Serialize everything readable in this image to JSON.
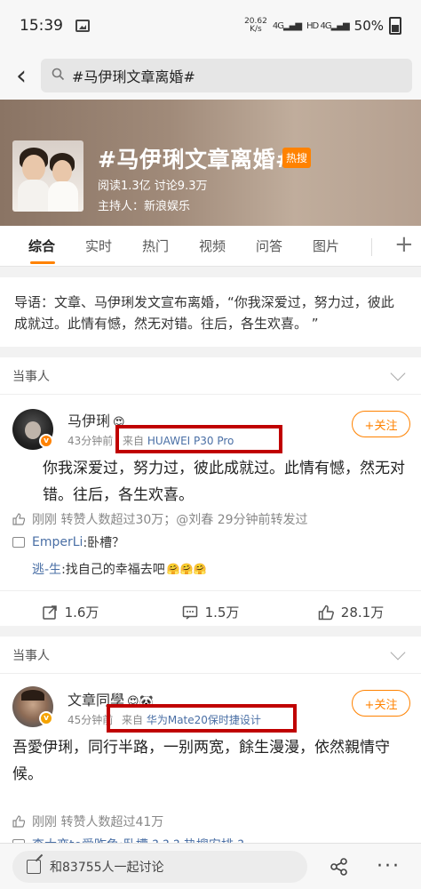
{
  "status": {
    "time": "15:39",
    "speed_top": "20.62",
    "speed_unit": "K/s",
    "network": "4G",
    "hd": "HD",
    "battery": "50%"
  },
  "search": {
    "query": "#马伊琍文章离婚#"
  },
  "topic": {
    "title": "#马伊琍文章离婚#",
    "badge": "热搜",
    "stats": "阅读1.3亿  讨论9.3万",
    "host": "主持人：新浪娱乐"
  },
  "tabs": [
    "综合",
    "实时",
    "热门",
    "视频",
    "问答",
    "图片"
  ],
  "guide": "导语：文章、马伊琍发文宣布离婚，“你我深爱过，努力过，彼此成就过。此情有憾，然无对错。往后，各生欢喜。 ”",
  "posts": [
    {
      "section": "当事人",
      "name": "马伊琍",
      "time": "43分钟前",
      "source_prefix": "来自",
      "device": "HUAWEI P30 Pro",
      "follow": "+关注",
      "body": "你我深爱过，努力过，彼此成就过。此情有憾，然无对错。往后，各生欢喜。",
      "repost": "刚刚 转赞人数超过30万；@刘春 29分钟前转发过",
      "comments": [
        {
          "user": "EmperLi",
          "text": ":卧槽？"
        },
        {
          "user": "逃-生",
          "text": ":找自己的幸福去吧"
        }
      ],
      "actions": {
        "repost": "1.6万",
        "comment": "1.5万",
        "like": "28.1万"
      },
      "verify_color": "#ff8200"
    },
    {
      "section": "当事人",
      "name": "文章同學",
      "time": "45分钟前",
      "source_prefix": "来自",
      "device": "华为Mate20保时捷设计",
      "follow": "+关注",
      "body": "吾愛伊琍，同行半路，一别两宽，餘生漫漫，依然親情守候。",
      "repost": "刚刚 转赞人数超过41万",
      "partial": "李大恋to爱昨龟:卧槽 ? ? ? 热搜安排 ?",
      "verify_color": "#f5a300"
    }
  ],
  "bottom": {
    "discuss": "和83755人一起讨论"
  },
  "icons": [
    "back-icon",
    "search-icon",
    "plus-icon",
    "chevron-down-icon",
    "repost-icon",
    "comment-icon",
    "like-icon",
    "pencil-icon",
    "share-icon",
    "more-icon"
  ]
}
